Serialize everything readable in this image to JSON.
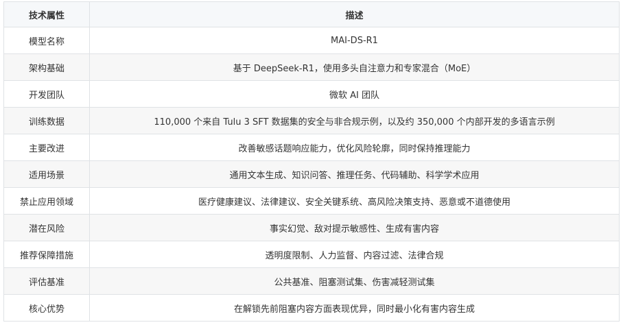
{
  "table": {
    "headers": [
      "技术属性",
      "描述"
    ],
    "rows": [
      [
        "模型名称",
        "MAI-DS-R1"
      ],
      [
        "架构基础",
        "基于 DeepSeek-R1，使用多头自注意力和专家混合（MoE）"
      ],
      [
        "开发团队",
        "微软 AI 团队"
      ],
      [
        "训练数据",
        "110,000 个来自 Tulu 3 SFT 数据集的安全与非合规示例，以及约 350,000 个内部开发的多语言示例"
      ],
      [
        "主要改进",
        "改善敏感话题响应能力，优化风险轮廓，同时保持推理能力"
      ],
      [
        "适用场景",
        "通用文本生成、知识问答、推理任务、代码辅助、科学学术应用"
      ],
      [
        "禁止应用领域",
        "医疗健康建议、法律建议、安全关键系统、高风险决策支持、恶意或不道德使用"
      ],
      [
        "潜在风险",
        "事实幻觉、敌对提示敏感性、生成有害内容"
      ],
      [
        "推荐保障措施",
        "透明度限制、人力监督、内容过滤、法律合规"
      ],
      [
        "评估基准",
        "公共基准、阻塞测试集、伤害减轻测试集"
      ],
      [
        "核心优势",
        "在解锁先前阻塞内容方面表现优异，同时最小化有害内容生成"
      ]
    ]
  }
}
